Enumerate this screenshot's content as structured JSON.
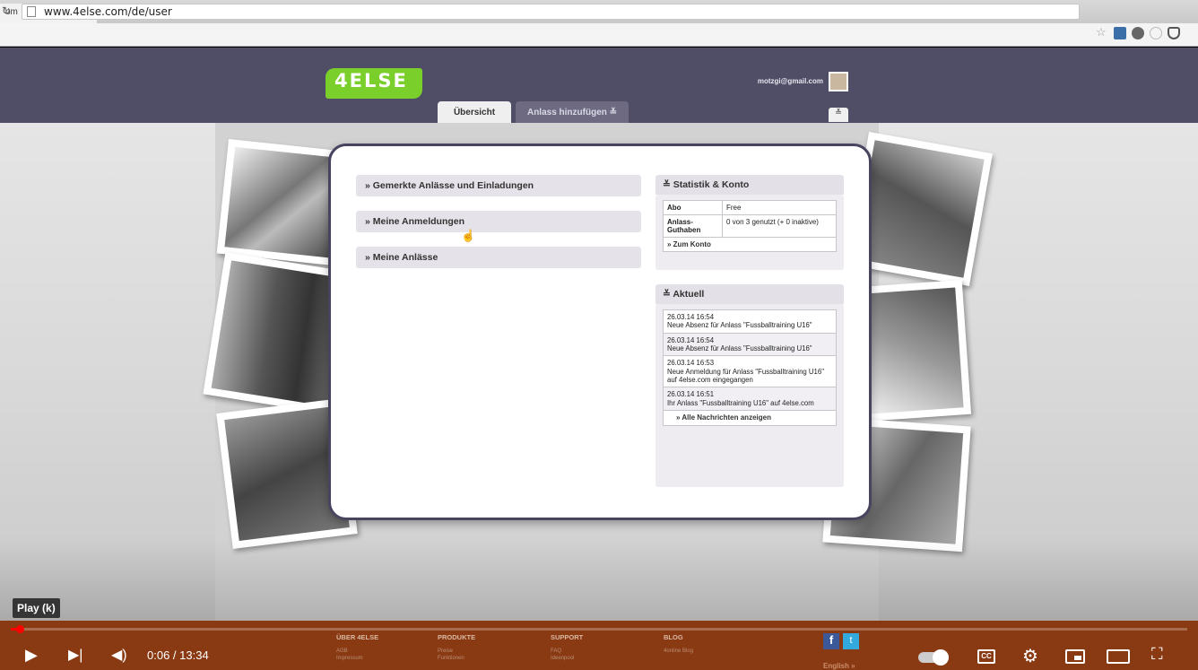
{
  "browser": {
    "tab_title": "om",
    "tab_close": "×",
    "url": "www.4else.com/de/user"
  },
  "site": {
    "logo": "4ELSE",
    "user_email": "motzgi@gmail.com",
    "menu_icon": "≚",
    "tabs": [
      {
        "label": "Übersicht",
        "active": true
      },
      {
        "label": "Anlass hinzufügen ≚",
        "active": false
      }
    ],
    "left_sections": [
      "» Gemerkte Anlässe und Einladungen",
      "» Meine Anmeldungen",
      "» Meine Anlässe"
    ],
    "stats": {
      "header": "≚ Statistik & Konto",
      "rows": [
        {
          "label": "Abo",
          "value": "Free"
        },
        {
          "label": "Anlass-Guthaben",
          "value": "0 von 3 genutzt (+ 0 inaktive)"
        }
      ],
      "link": "» Zum Konto"
    },
    "news": {
      "header": "≚ Aktuell",
      "items": [
        {
          "time": "26.03.14 16:54",
          "text": "Neue Absenz für Anlass \"Fussballtraining U16\""
        },
        {
          "time": "26.03.14 16:54",
          "text": "Neue Absenz für Anlass \"Fussballtraining U16\""
        },
        {
          "time": "26.03.14 16:53",
          "text": "Neue Anmeldung für Anlass \"Fussballtraining U16\" auf 4else.com eingegangen"
        },
        {
          "time": "26.03.14 16:51",
          "text": "Ihr Anlass \"Fussballtraining U16\" auf 4else.com"
        }
      ],
      "link": "» Alle Nachrichten anzeigen"
    },
    "footer": {
      "columns": [
        {
          "title": "ÜBER 4ELSE",
          "items": [
            "AGB",
            "Impressum"
          ]
        },
        {
          "title": "PRODUKTE",
          "items": [
            "Preise",
            "Funktionen"
          ]
        },
        {
          "title": "SUPPORT",
          "items": [
            "FAQ",
            "Ideenpool"
          ]
        },
        {
          "title": "BLOG",
          "items": [
            "4online Blog"
          ]
        }
      ],
      "language": "English »"
    }
  },
  "player": {
    "tooltip": "Play (k)",
    "time": "0:06 / 13:34",
    "progress_fraction": 0.0075,
    "accent": "#ff0000"
  }
}
